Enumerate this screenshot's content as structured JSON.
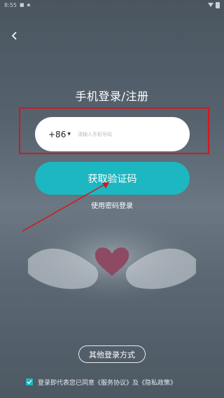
{
  "status_bar": {
    "time": "8:55",
    "icons": [
      "notification-icon",
      "sim-icon",
      "wifi-icon",
      "battery-icon"
    ]
  },
  "nav": {
    "back_icon": "chevron-left-icon"
  },
  "page": {
    "title": "手机登录/注册"
  },
  "phone": {
    "country_code": "+86",
    "placeholder": "请输入手机号码"
  },
  "buttons": {
    "get_code": "获取验证码",
    "password_login": "使用密码登录",
    "other_login": "其他登录方式"
  },
  "agreement": {
    "checked": true,
    "prefix": "登录即代表您已同意",
    "service_link": "《服务协议》",
    "connector": "及",
    "privacy_link": "《隐私政策》"
  },
  "colors": {
    "accent": "#1cb7c0",
    "highlight_box": "#d6161d",
    "background": "#56626d"
  }
}
